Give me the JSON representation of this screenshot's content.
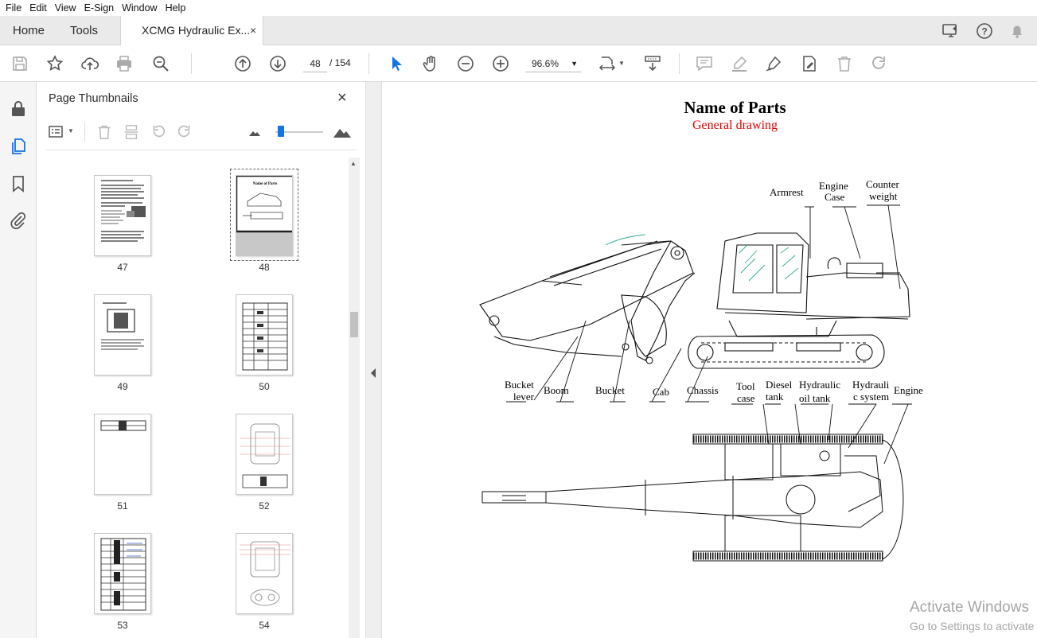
{
  "menu": [
    "File",
    "Edit",
    "View",
    "E-Sign",
    "Window",
    "Help"
  ],
  "tabs": {
    "home": "Home",
    "tools": "Tools",
    "document": "XCMG Hydraulic Ex...",
    "close": "×"
  },
  "toolbar": {
    "page_current": "48",
    "page_total": "/ 154",
    "zoom": "96.6%"
  },
  "panel": {
    "title": "Page Thumbnails",
    "close": "×",
    "pages": [
      "47",
      "48",
      "49",
      "50",
      "51",
      "52",
      "53",
      "54"
    ],
    "selected_page": "48"
  },
  "document": {
    "title": "Name of Parts",
    "subtitle": "General drawing",
    "labels": {
      "armrest": "Armrest",
      "engine_case_1": "Engine",
      "engine_case_2": "Case",
      "counter_weight_1": "Counter",
      "counter_weight_2": "weight",
      "bucket_lever_1": "Bucket",
      "bucket_lever_2": "lever",
      "boom": "Boom",
      "bucket": "Bucket",
      "cab": "Cab",
      "chassis": "Chassis",
      "tool_case_1": "Tool",
      "tool_case_2": "case",
      "diesel_tank_1": "Diesel",
      "diesel_tank_2": "tank",
      "hydraulic_oil_tank_1": "Hydraulic",
      "hydraulic_oil_tank_2": "oil tank",
      "hydraulic_system_1": "Hydrauli",
      "hydraulic_system_2": "c system",
      "engine": "Engine"
    },
    "subtitle_color": "#e00000"
  },
  "watermark": {
    "line1": "Activate Windows",
    "line2": "Go to Settings to activate Windows."
  },
  "colors": {
    "accent_blue": "#1473e6",
    "panel_bg": "#f5f5f5",
    "tabbar_bg": "#eaeaea"
  }
}
